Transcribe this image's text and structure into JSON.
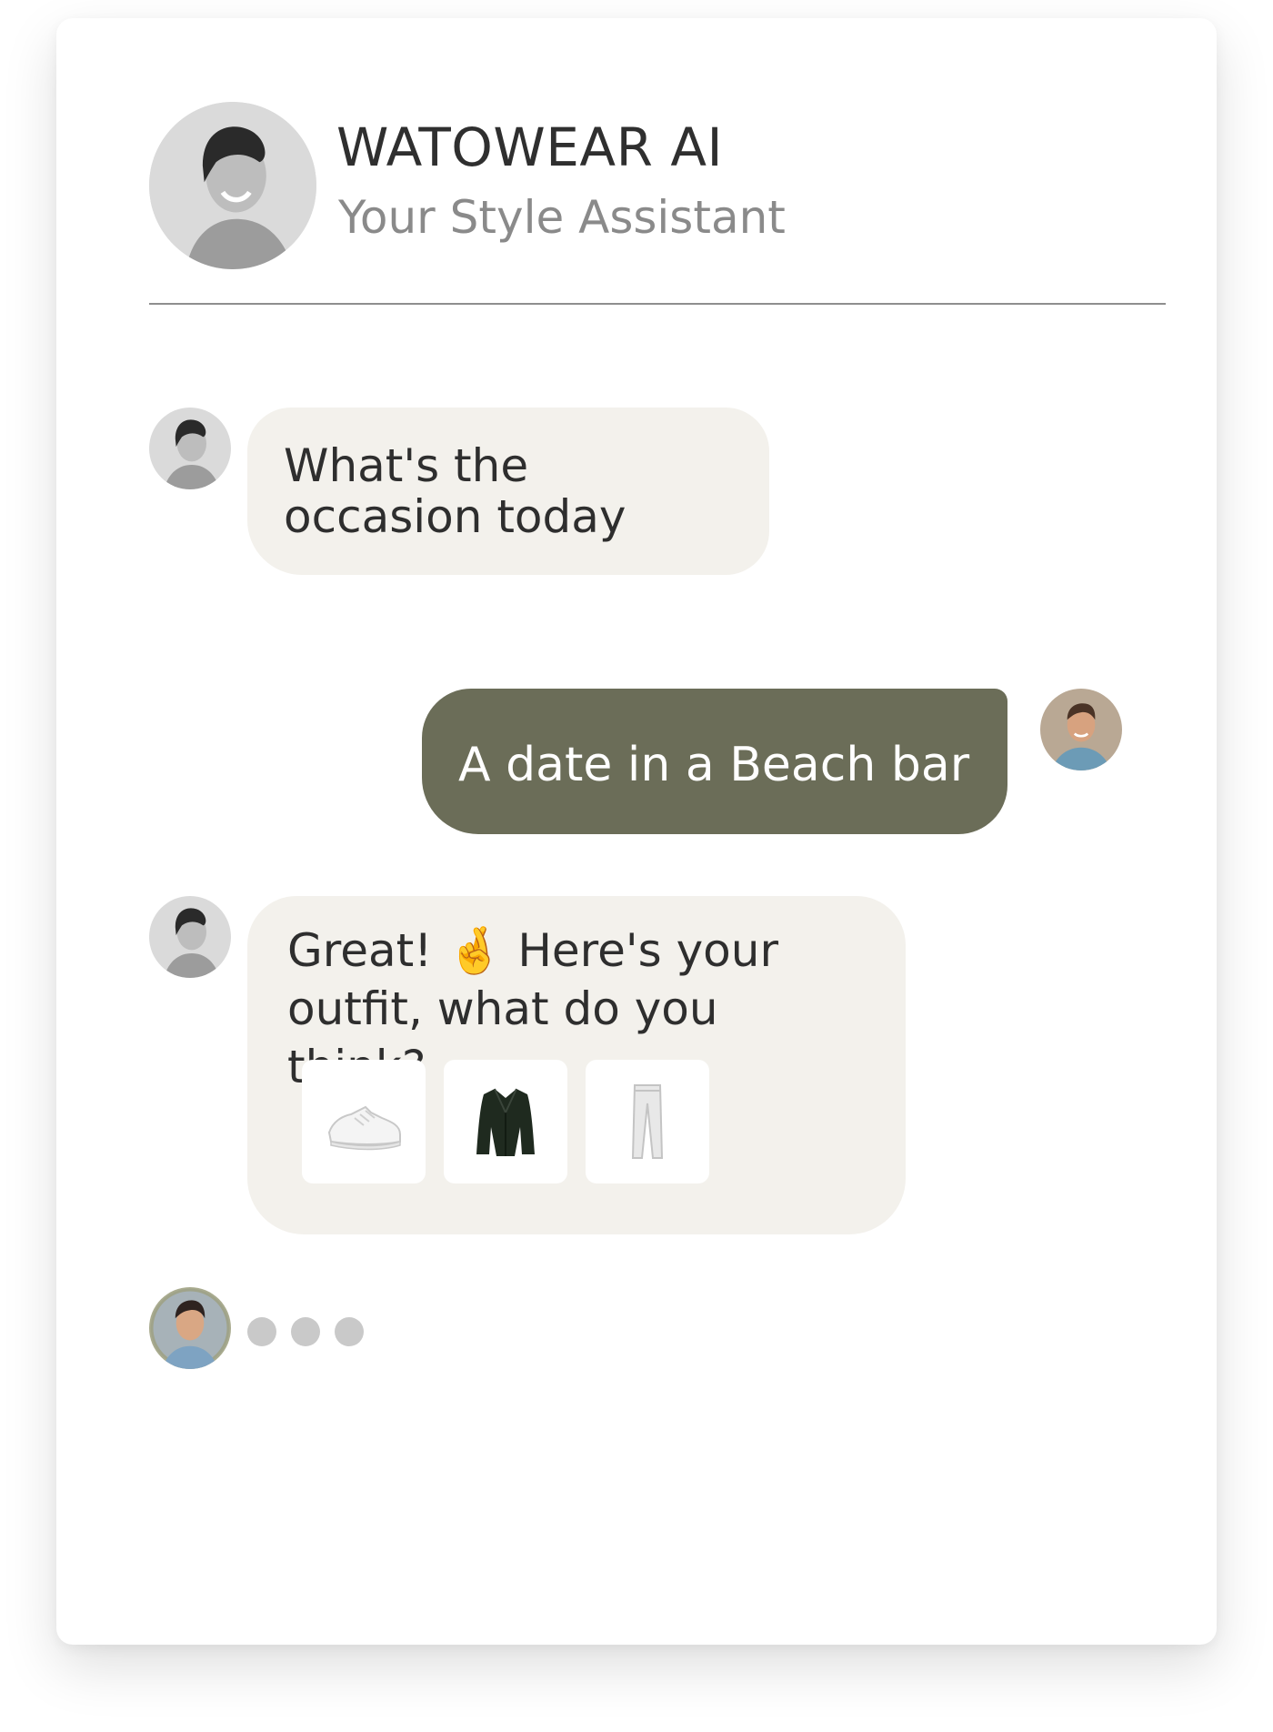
{
  "header": {
    "title": "WATOWEAR AI",
    "subtitle": "Your Style Assistant"
  },
  "messages": [
    {
      "sender": "assistant",
      "text": "What's the occasion today"
    },
    {
      "sender": "user",
      "text": "A date in a Beach bar"
    },
    {
      "sender": "assistant",
      "text_part1": "Great! ",
      "emoji": "🤞",
      "text_part2": " Here's your outfit, what do you think?"
    }
  ],
  "outfit_items": [
    {
      "icon": "sneakers-icon"
    },
    {
      "icon": "blazer-icon"
    },
    {
      "icon": "trousers-icon"
    }
  ],
  "typing_indicator_dots": 3,
  "colors": {
    "assistant_bubble": "#f3f1ec",
    "user_bubble": "#6b6d58",
    "divider": "#8e8e8e",
    "typing_dot": "#c9c9c9"
  }
}
